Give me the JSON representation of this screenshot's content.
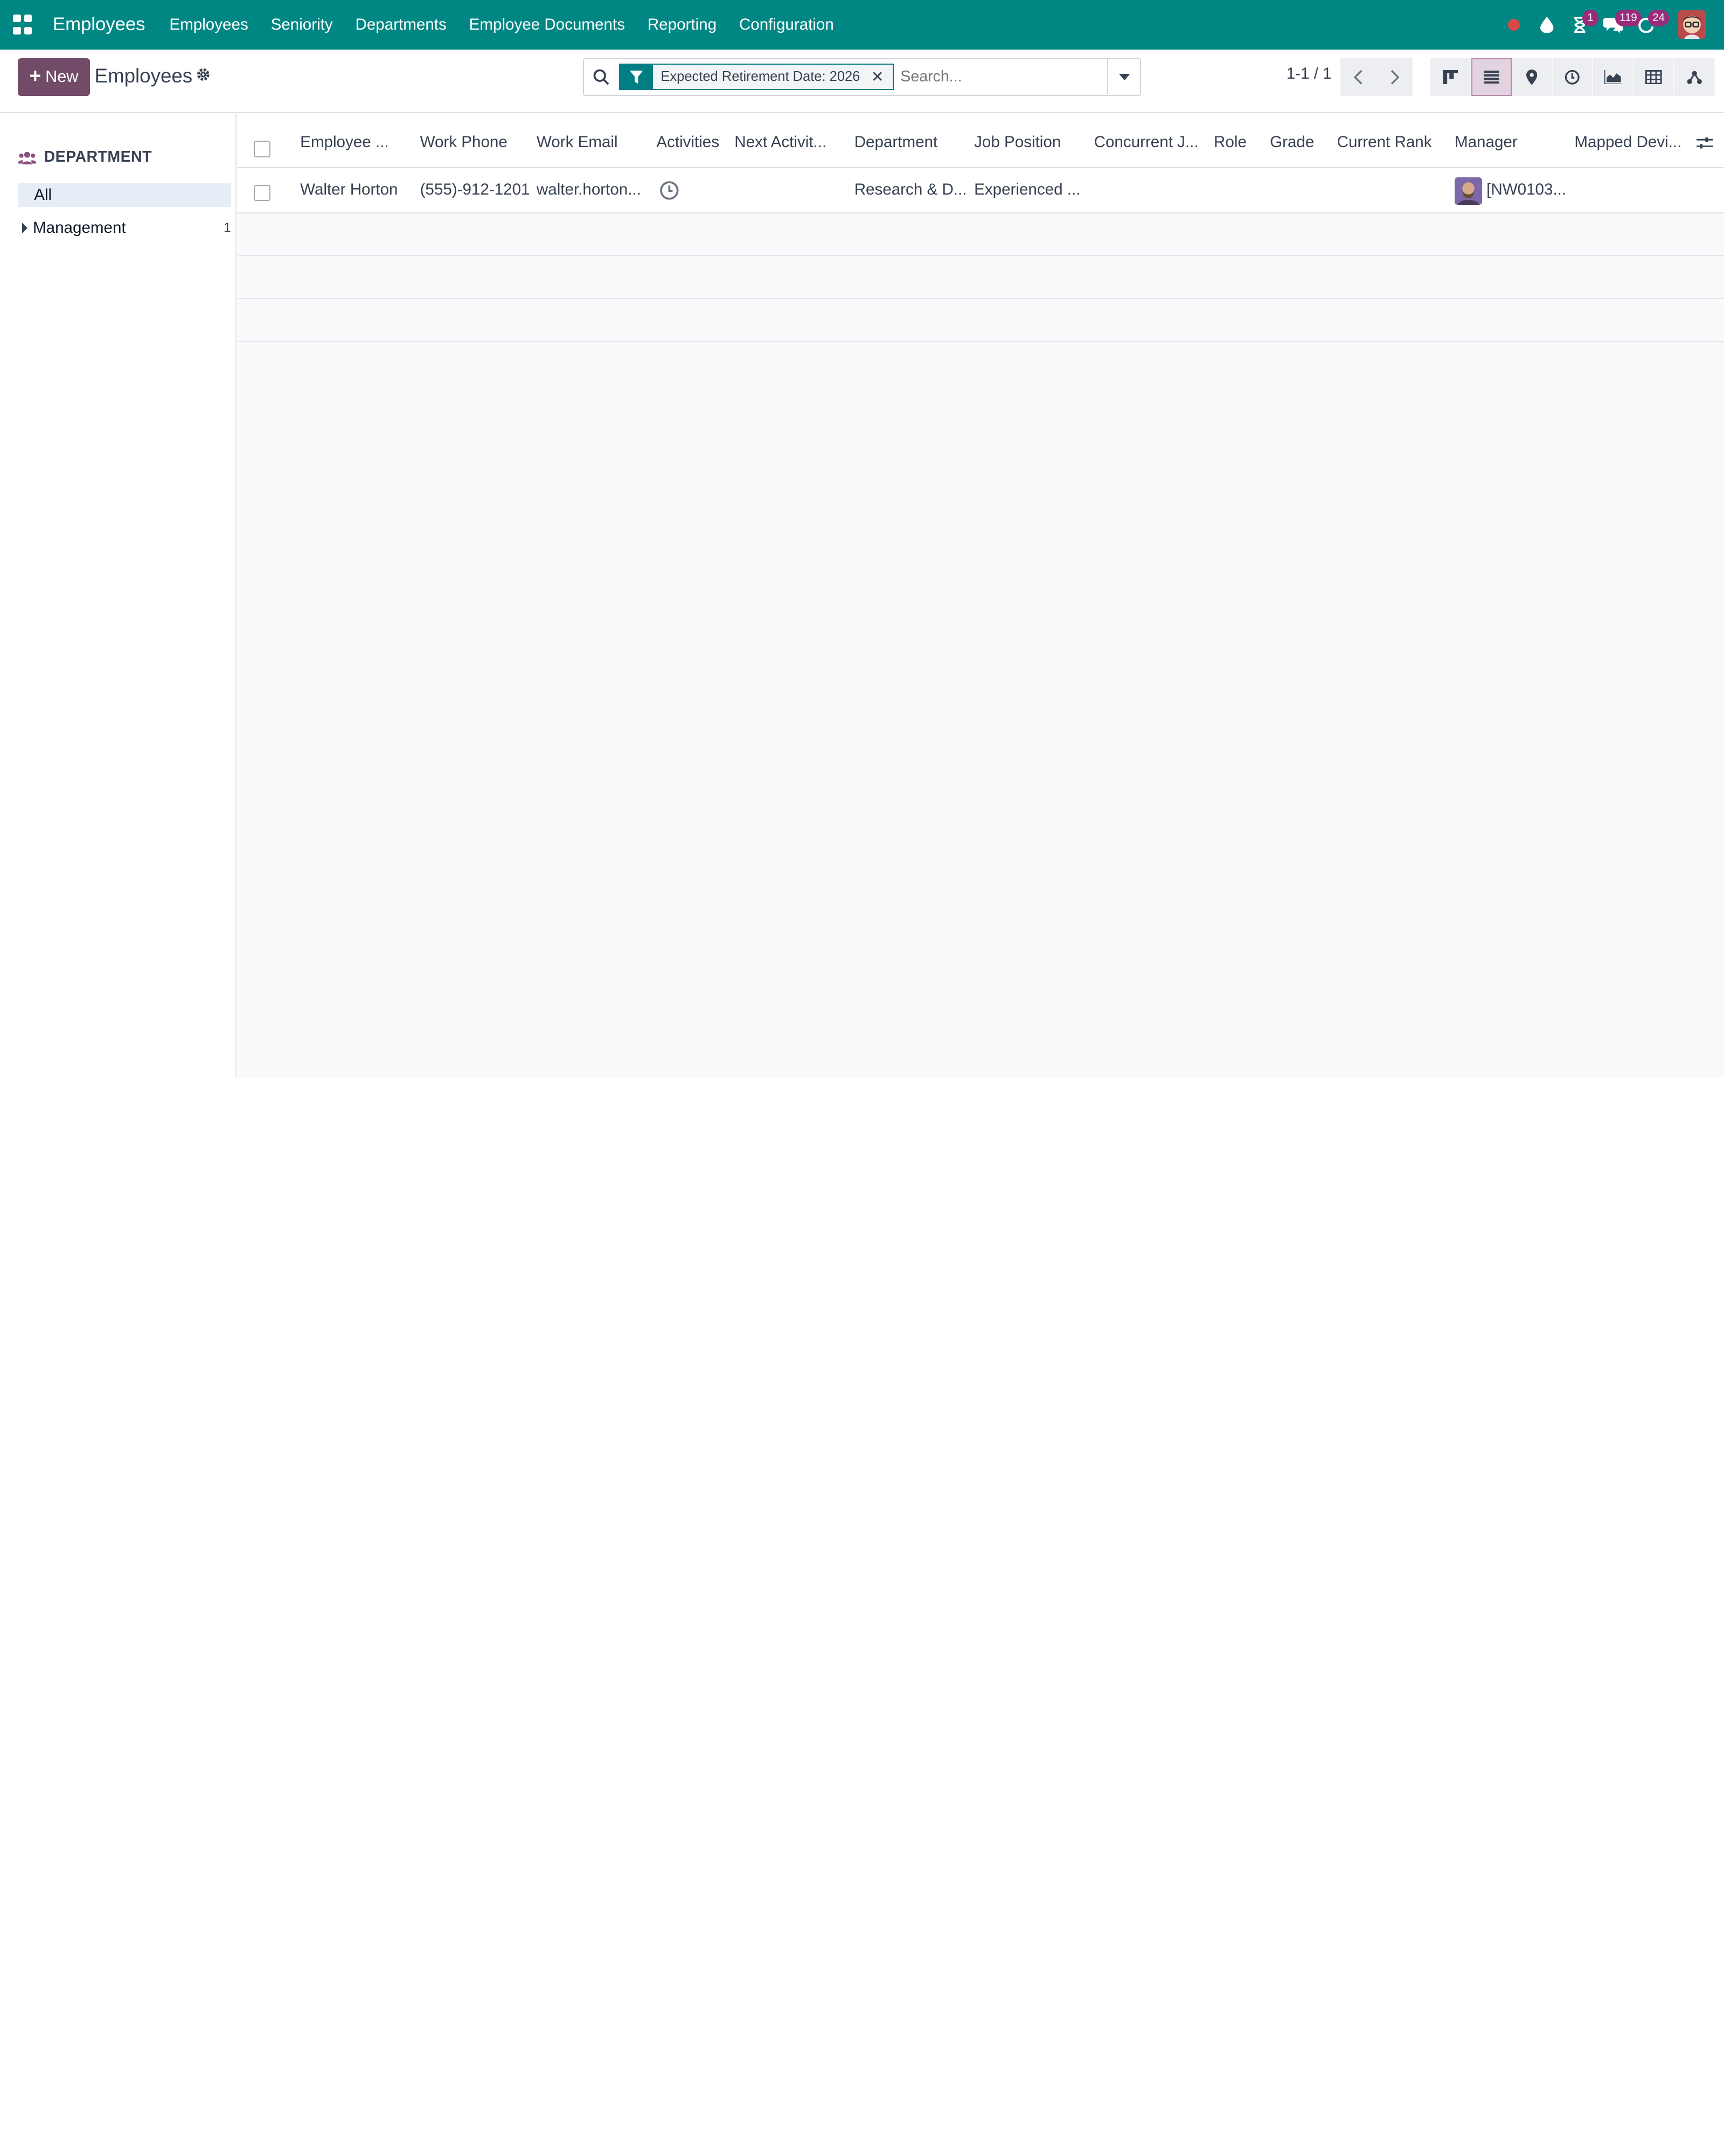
{
  "navbar": {
    "app_name": "Employees",
    "menu": [
      "Employees",
      "Seniority",
      "Departments",
      "Employee Documents",
      "Reporting",
      "Configuration"
    ],
    "systray": {
      "activity_badge": "1",
      "messages_badge": "119",
      "updates_badge": "24"
    }
  },
  "control": {
    "new_label": "New",
    "title": "Employees",
    "search": {
      "facet_value": "Expected Retirement Date: 2026",
      "placeholder": "Search..."
    },
    "pager": "1-1 / 1",
    "views": [
      "kanban",
      "list",
      "map",
      "activity",
      "graph",
      "pivot",
      "hierarchy"
    ],
    "active_view": "list"
  },
  "sidepanel": {
    "header": "DEPARTMENT",
    "all_label": "All",
    "items": [
      {
        "label": "Management",
        "count": "1"
      }
    ]
  },
  "list": {
    "columns": [
      "Employee ...",
      "Work Phone",
      "Work Email",
      "Activities",
      "Next Activit...",
      "Department",
      "Job Position",
      "Concurrent J...",
      "Role",
      "Grade",
      "Current Rank",
      "Manager",
      "Mapped Devi..."
    ],
    "rows": [
      {
        "employee": "Walter Horton",
        "work_phone": "(555)-912-1201",
        "work_email": "walter.horton...",
        "department": "Research & D...",
        "job_position": "Experienced ...",
        "manager": "[NW0103..."
      }
    ]
  },
  "colors": {
    "navbar": "#008784",
    "primary": "#714b67",
    "filter_accent": "#017e84",
    "badge": "#9a2b7a"
  }
}
